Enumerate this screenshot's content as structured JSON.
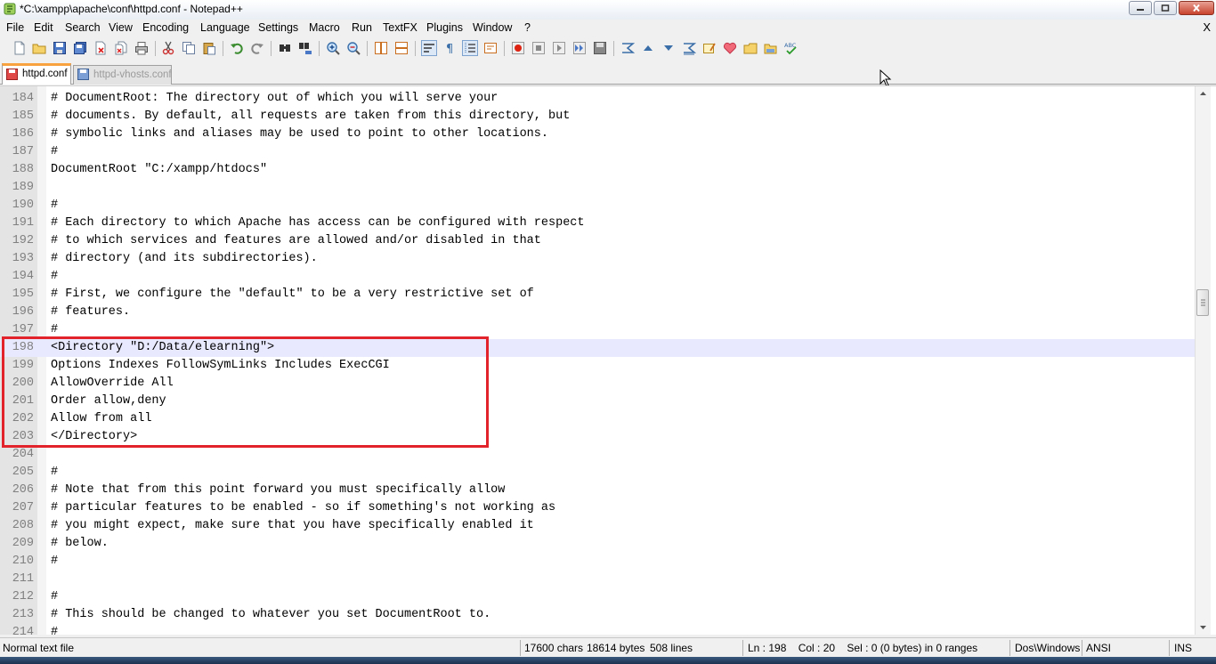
{
  "window": {
    "title": "*C:\\xampp\\apache\\conf\\httpd.conf - Notepad++"
  },
  "menu": {
    "items": [
      "File",
      "Edit",
      "Search",
      "View",
      "Encoding",
      "Language",
      "Settings",
      "Macro",
      "Run",
      "TextFX",
      "Plugins",
      "Window",
      "?"
    ],
    "close_label": "X"
  },
  "toolbar": {
    "icons": [
      "new-file-icon",
      "open-file-icon",
      "save-icon",
      "save-all-icon",
      "close-icon",
      "close-all-icon",
      "print-icon",
      "cut-icon",
      "copy-icon",
      "paste-icon",
      "undo-icon",
      "redo-icon",
      "find-icon",
      "replace-icon",
      "zoom-in-icon",
      "zoom-out-icon",
      "sync-vertical-icon",
      "sync-horizontal-icon",
      "word-wrap-icon",
      "show-all-chars-icon",
      "indent-guide-icon",
      "doc-map-icon",
      "record-macro-icon",
      "stop-record-icon",
      "play-macro-icon",
      "run-macro-multiple-icon",
      "save-macro-icon",
      "textfx-sort-icon",
      "textfx-up-icon",
      "textfx-down-icon",
      "textfx-case-icon",
      "textfx-edit-icon",
      "heart-icon",
      "folder-icon",
      "folder-open-icon",
      "spellcheck-icon"
    ]
  },
  "tabs": [
    {
      "label": "httpd.conf",
      "active": true
    },
    {
      "label": "httpd-vhosts.conf",
      "active": false
    }
  ],
  "editor": {
    "current_line": 198,
    "lines": [
      {
        "num": "184",
        "text": "# DocumentRoot: The directory out of which you will serve your"
      },
      {
        "num": "185",
        "text": "# documents. By default, all requests are taken from this directory, but"
      },
      {
        "num": "186",
        "text": "# symbolic links and aliases may be used to point to other locations."
      },
      {
        "num": "187",
        "text": "#"
      },
      {
        "num": "188",
        "text": "DocumentRoot \"C:/xampp/htdocs\""
      },
      {
        "num": "189",
        "text": ""
      },
      {
        "num": "190",
        "text": "#"
      },
      {
        "num": "191",
        "text": "# Each directory to which Apache has access can be configured with respect"
      },
      {
        "num": "192",
        "text": "# to which services and features are allowed and/or disabled in that"
      },
      {
        "num": "193",
        "text": "# directory (and its subdirectories)."
      },
      {
        "num": "194",
        "text": "#"
      },
      {
        "num": "195",
        "text": "# First, we configure the \"default\" to be a very restrictive set of"
      },
      {
        "num": "196",
        "text": "# features."
      },
      {
        "num": "197",
        "text": "#"
      },
      {
        "num": "198",
        "text": "<Directory \"D:/Data/elearning\">"
      },
      {
        "num": "199",
        "text": "Options Indexes FollowSymLinks Includes ExecCGI"
      },
      {
        "num": "200",
        "text": "AllowOverride All"
      },
      {
        "num": "201",
        "text": "Order allow,deny"
      },
      {
        "num": "202",
        "text": "Allow from all"
      },
      {
        "num": "203",
        "text": "</Directory>"
      },
      {
        "num": "204",
        "text": ""
      },
      {
        "num": "205",
        "text": "#"
      },
      {
        "num": "206",
        "text": "# Note that from this point forward you must specifically allow"
      },
      {
        "num": "207",
        "text": "# particular features to be enabled - so if something's not working as"
      },
      {
        "num": "208",
        "text": "# you might expect, make sure that you have specifically enabled it"
      },
      {
        "num": "209",
        "text": "# below."
      },
      {
        "num": "210",
        "text": "#"
      },
      {
        "num": "211",
        "text": ""
      },
      {
        "num": "212",
        "text": "#"
      },
      {
        "num": "213",
        "text": "# This should be changed to whatever you set DocumentRoot to."
      },
      {
        "num": "214",
        "text": "#"
      }
    ]
  },
  "status": {
    "file_type": "Normal text file",
    "chars": "17600 chars",
    "bytes": "18614 bytes",
    "lines": "508 lines",
    "position": "Ln : 198    Col : 20    Sel : 0 (0 bytes) in 0 ranges",
    "eol": "Dos\\Windows",
    "encoding": "ANSI",
    "mode": "INS"
  },
  "colors": {
    "highlight_box": "#e3232b",
    "current_line": "#e8e8ff",
    "active_tab_accent": "#f8a13f"
  }
}
